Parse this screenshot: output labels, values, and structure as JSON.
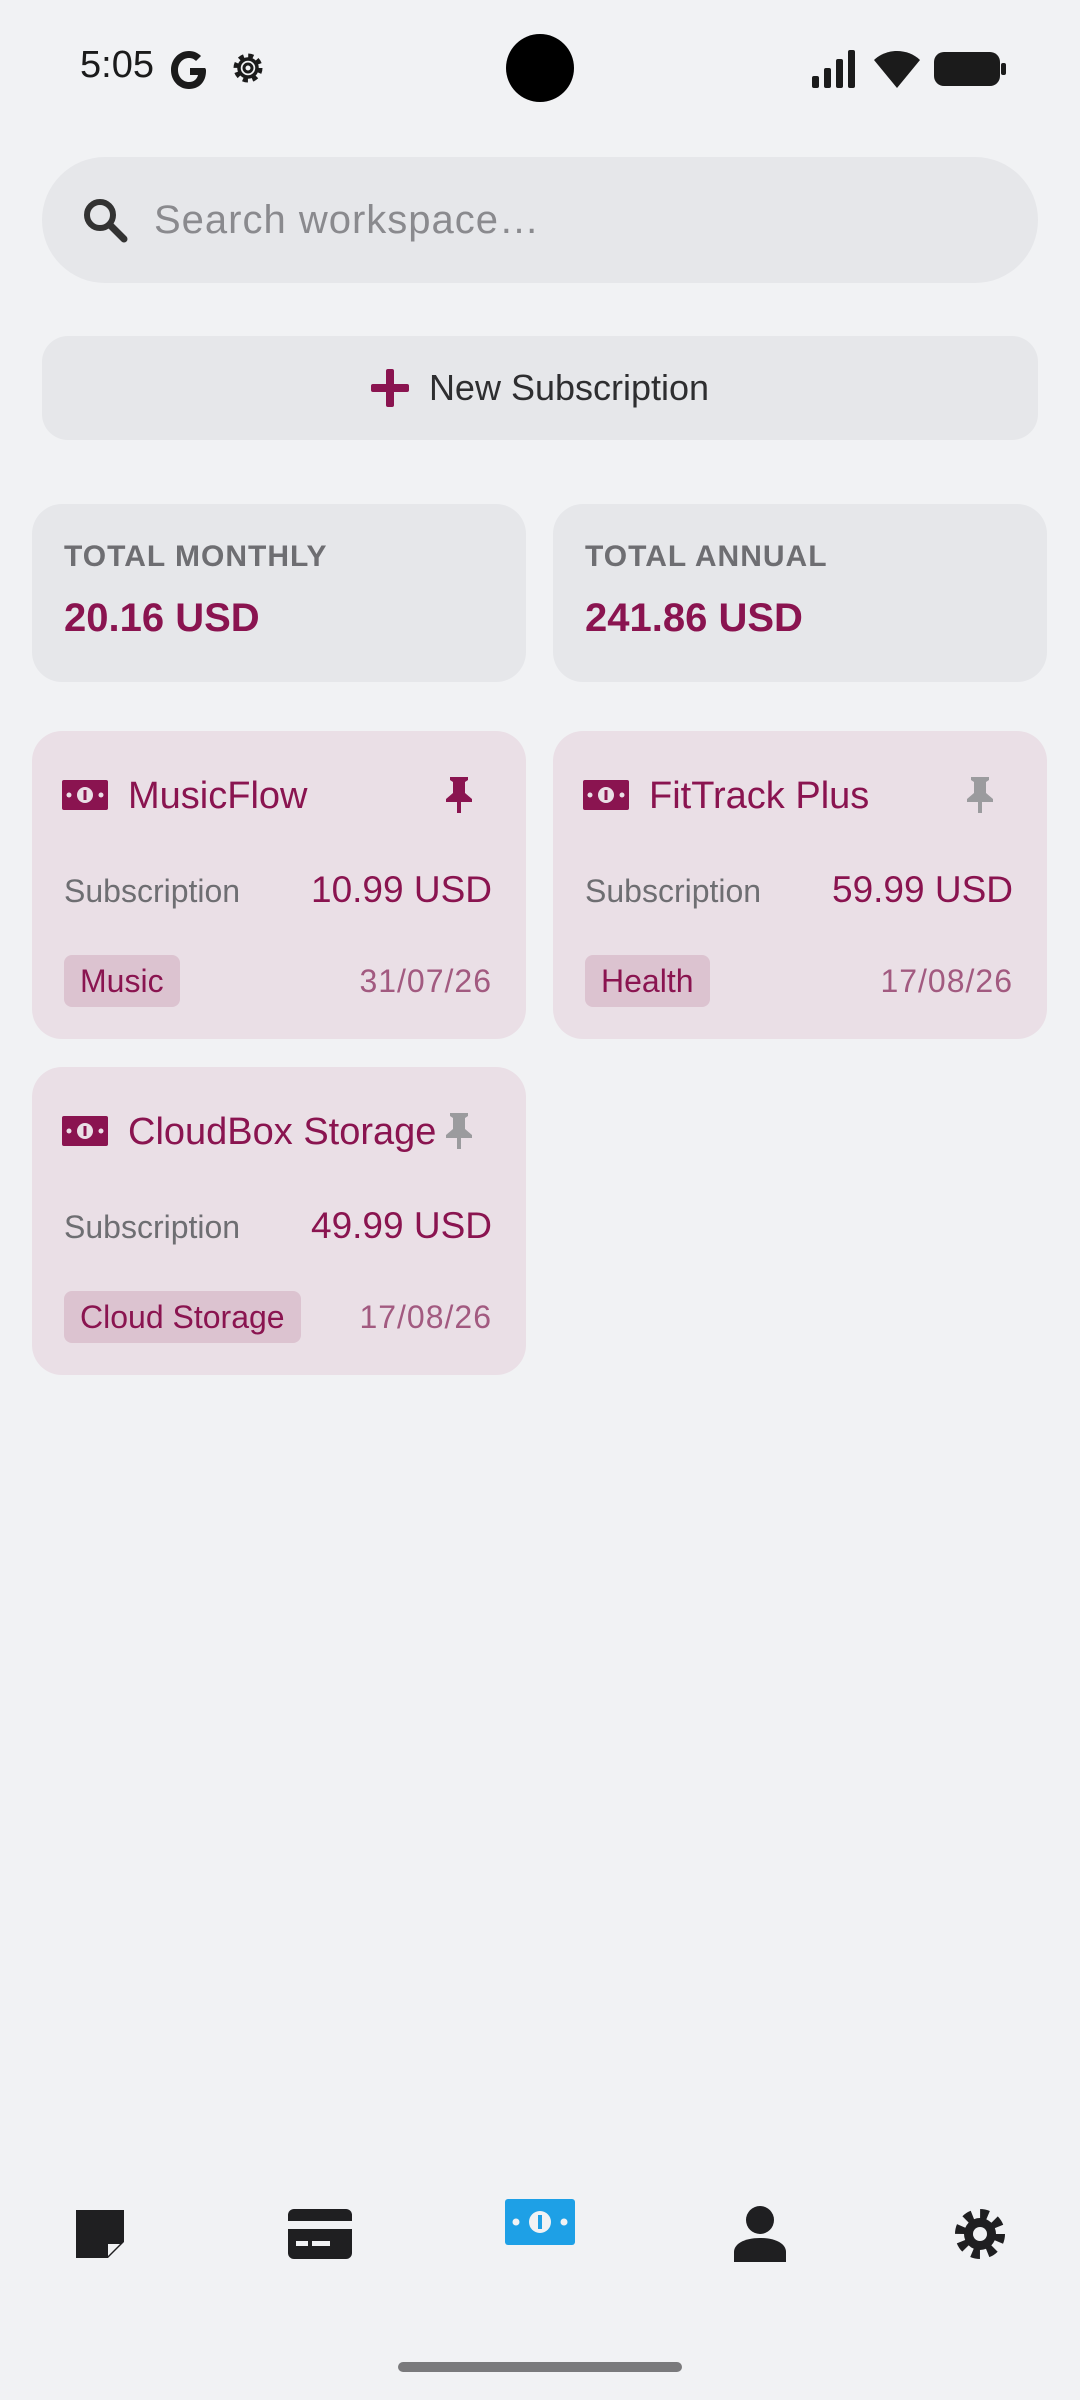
{
  "status_bar": {
    "time": "5:05",
    "icons": [
      "google-icon",
      "settings-gear-icon",
      "signal-icon",
      "wifi-icon",
      "battery-icon"
    ]
  },
  "search": {
    "placeholder": "Search workspace…",
    "value": ""
  },
  "new_subscription": {
    "label": "New Subscription",
    "icon": "plus-icon"
  },
  "totals": [
    {
      "label": "TOTAL MONTHLY",
      "value": "20.16 USD"
    },
    {
      "label": "TOTAL ANNUAL",
      "value": "241.86 USD"
    }
  ],
  "subscriptions": [
    {
      "name": "MusicFlow",
      "type": "Subscription",
      "amount": "10.99 USD",
      "tag": "Music",
      "date": "31/07/26",
      "pinned": true
    },
    {
      "name": "FitTrack Plus",
      "type": "Subscription",
      "amount": "59.99 USD",
      "tag": "Health",
      "date": "17/08/26",
      "pinned": false
    },
    {
      "name": "CloudBox Storage",
      "type": "Subscription",
      "amount": "49.99 USD",
      "tag": "Cloud Storage",
      "date": "17/08/26",
      "pinned": false
    }
  ],
  "bottom_nav": {
    "items": [
      "notes-icon",
      "credit-card-icon",
      "money-icon",
      "person-icon",
      "settings-icon"
    ],
    "active": "money-icon"
  },
  "colors": {
    "accent": "#8a1450",
    "active_nav": "#1ea0e6",
    "background": "#f1f2f4",
    "card": "#e6e7ea",
    "sub_card": "#eadfe6"
  }
}
